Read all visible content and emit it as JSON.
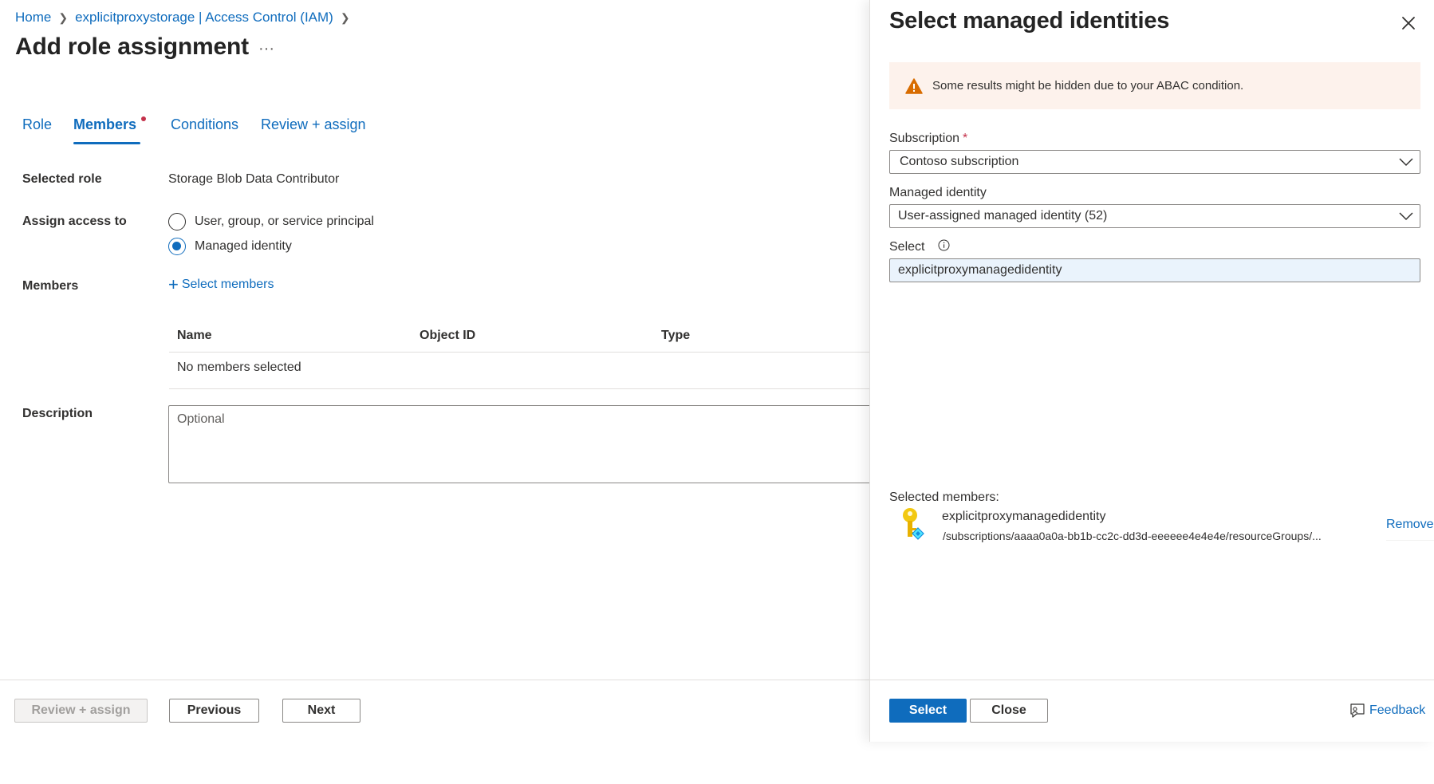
{
  "breadcrumb": {
    "home": "Home",
    "parent": "explicitproxystorage | Access Control (IAM)"
  },
  "page": {
    "title": "Add role assignment",
    "more": "···"
  },
  "tabs": [
    {
      "label": "Role"
    },
    {
      "label": "Members",
      "active": true
    },
    {
      "label": "Conditions"
    },
    {
      "label": "Review + assign"
    }
  ],
  "form": {
    "selected_role_label": "Selected role",
    "selected_role_value": "Storage Blob Data Contributor",
    "assign_access_label": "Assign access to",
    "assign_options": [
      "User, group, or service principal",
      "Managed identity"
    ],
    "assign_selected": "Managed identity",
    "members_label": "Members",
    "select_members": "Select members",
    "table_headers": [
      "Name",
      "Object ID",
      "Type"
    ],
    "table_empty": "No members selected",
    "description_label": "Description",
    "description_placeholder": "Optional"
  },
  "footer": {
    "review_assign": "Review + assign",
    "previous": "Previous",
    "next": "Next"
  },
  "panel": {
    "title": "Select managed identities",
    "warning": "Some results might be hidden due to your ABAC condition.",
    "subscription_label": "Subscription",
    "required_mark": "*",
    "subscription_value": "Contoso subscription",
    "managed_identity_label": "Managed identity",
    "managed_identity_value": "User-assigned managed identity (52)",
    "select_label": "Select",
    "select_value": "explicitproxymanagedidentity",
    "selected_members_label": "Selected members:",
    "selected_member": {
      "name": "explicitproxymanagedidentity",
      "path": "/subscriptions/aaaa0a0a-bb1b-cc2c-dd3d-eeeeee4e4e4e/resourceGroups/..."
    },
    "remove": "Remove",
    "select_button": "Select",
    "close_button": "Close",
    "feedback": "Feedback"
  },
  "colors": {
    "accent": "#0f6cbd",
    "warning_bg": "#fdf2ec",
    "warning_icon": "#d86c00",
    "required": "#c4314b"
  }
}
